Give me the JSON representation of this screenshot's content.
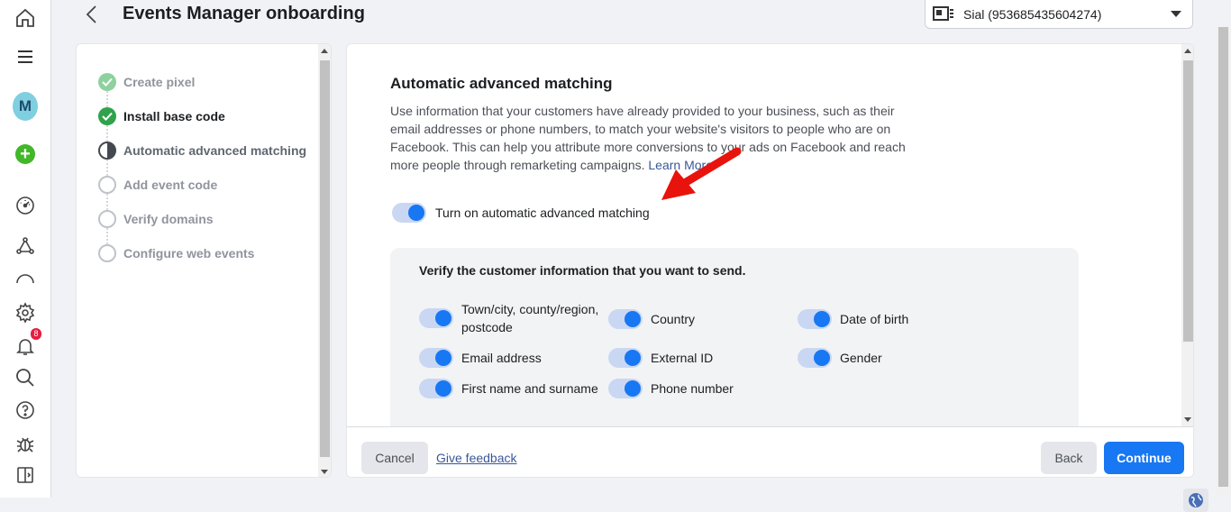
{
  "header": {
    "title": "Events Manager onboarding",
    "account": "Sial (953685435604274)"
  },
  "rail": {
    "avatar_letter": "M",
    "plus": "+",
    "notifications_count": "8",
    "icons": [
      "home-icon",
      "menu-icon",
      "avatar",
      "create-icon",
      "dashboard-icon",
      "data-sources-icon",
      "partial-icon",
      "settings-icon",
      "notifications-icon",
      "search-icon",
      "help-icon",
      "debug-icon",
      "panel-icon"
    ]
  },
  "steps": [
    {
      "label": "Create pixel",
      "state": "done"
    },
    {
      "label": "Install base code",
      "state": "done-active"
    },
    {
      "label": "Automatic advanced matching",
      "state": "current"
    },
    {
      "label": "Add event code",
      "state": "todo"
    },
    {
      "label": "Verify domains",
      "state": "todo"
    },
    {
      "label": "Configure web events",
      "state": "todo"
    }
  ],
  "main": {
    "title": "Automatic advanced matching",
    "description": "Use information that your customers have already provided to your business, such as their email addresses or phone numbers, to match your website's visitors to people who are on Facebook. This can help you attribute more conversions to your ads on Facebook and reach more people through remarketing campaigns.",
    "learn_more": "Learn More",
    "toggle_label": "Turn on automatic advanced matching",
    "verify_title": "Verify the customer information that you want to send.",
    "fields": [
      "Town/city, county/region, postcode",
      "Country",
      "Date of birth",
      "Email address",
      "External ID",
      "Gender",
      "First name and surname",
      "Phone number"
    ]
  },
  "footer": {
    "cancel": "Cancel",
    "feedback": "Give feedback",
    "back": "Back",
    "continue": "Continue"
  },
  "colors": {
    "primary": "#1877f2",
    "toggle_track": "#c9d7f3",
    "step_done": "#31a24c",
    "arrow": "#e8130c"
  }
}
